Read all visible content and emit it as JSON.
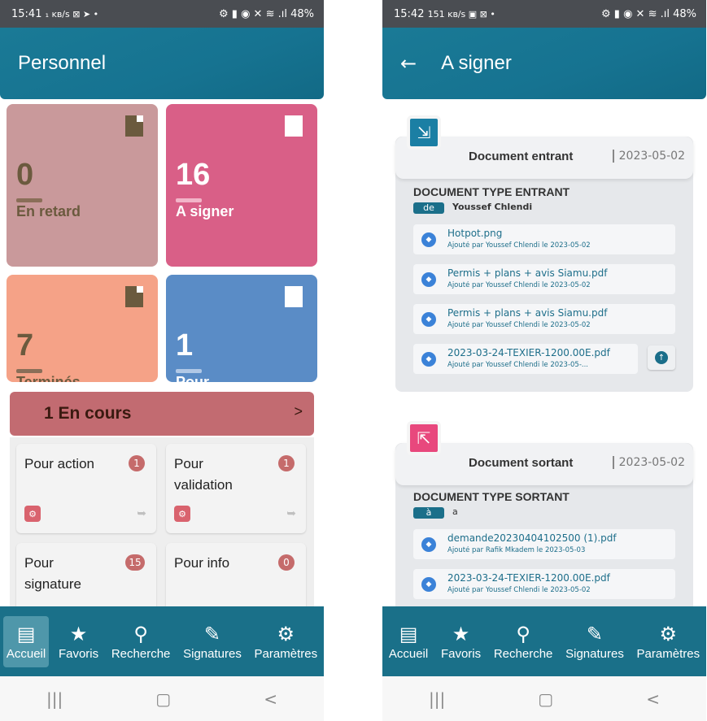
{
  "left": {
    "status": {
      "time": "15:41",
      "indicators": "₁ ᴋʙ/s ⊠ ➤ •",
      "battery": "48%"
    },
    "appbar_title": "Personnel",
    "tiles": [
      {
        "count": "0",
        "label": "En retard",
        "color": "#c9999b"
      },
      {
        "count": "16",
        "label": "A signer",
        "color": "#d95f87"
      },
      {
        "count": "7",
        "label": "Terminés",
        "color": "#f5a287"
      },
      {
        "count": "1",
        "label": "Pour",
        "color": "#5a8cc6"
      }
    ],
    "en_cours": {
      "label": "1  En cours",
      "chevron": ">"
    },
    "cards": [
      {
        "title": "Pour action",
        "badge": "1"
      },
      {
        "title": "Pour validation",
        "badge": "1"
      },
      {
        "title": "Pour signature",
        "badge": "15"
      },
      {
        "title": "Pour info",
        "badge": "0"
      }
    ]
  },
  "right": {
    "status": {
      "time": "15:42",
      "indicators": "151 ᴋʙ/s ▣ ⊠ •",
      "battery": "48%"
    },
    "appbar_title": "A signer",
    "incoming": {
      "title": "Document entrant",
      "date": "2023-05-02",
      "doc_type": "DOCUMENT TYPE ENTRANT",
      "pill": "de",
      "sender": "Youssef Chlendi",
      "files": [
        {
          "name": "Hotpot.png",
          "meta": "Ajouté par Youssef Chlendi le 2023-05-02"
        },
        {
          "name": "Permis + plans + avis Siamu.pdf",
          "meta": "Ajouté par Youssef Chlendi le 2023-05-02"
        },
        {
          "name": "Permis + plans + avis Siamu.pdf",
          "meta": "Ajouté par Youssef Chlendi le 2023-05-02"
        },
        {
          "name": "2023-03-24-TEXIER-1200.00E.pdf",
          "meta": "Ajouté par Youssef Chlendi le 2023-05-..."
        }
      ]
    },
    "outgoing": {
      "title": "Document sortant",
      "date": "2023-05-02",
      "doc_type": "DOCUMENT TYPE SORTANT",
      "pill": "à",
      "sender": "a",
      "files": [
        {
          "name": "demande20230404102500 (1).pdf",
          "meta": "Ajouté par Rafik Mkadem le 2023-05-03"
        },
        {
          "name": "2023-03-24-TEXIER-1200.00E.pdf",
          "meta": "Ajouté par Youssef Chlendi le 2023-05-02"
        }
      ]
    }
  },
  "nav": {
    "items": [
      {
        "label": "Accueil",
        "icon": "inbox-icon"
      },
      {
        "label": "Favoris",
        "icon": "star-icon"
      },
      {
        "label": "Recherche",
        "icon": "search-icon"
      },
      {
        "label": "Signatures",
        "icon": "signature-icon"
      },
      {
        "label": "Paramètres",
        "icon": "gear-icon"
      }
    ]
  }
}
